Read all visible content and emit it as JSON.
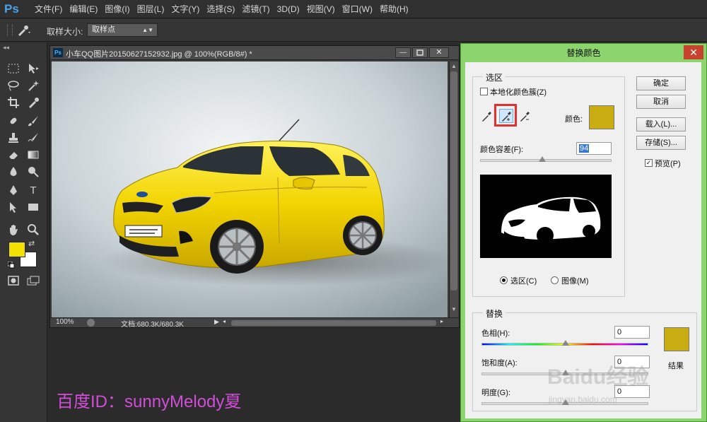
{
  "app": {
    "logo": "Ps"
  },
  "menu": [
    "文件(F)",
    "编辑(E)",
    "图像(I)",
    "图层(L)",
    "文字(Y)",
    "选择(S)",
    "滤镜(T)",
    "3D(D)",
    "视图(V)",
    "窗口(W)",
    "帮助(H)"
  ],
  "options": {
    "sample_size_label": "取样大小:",
    "sample_size_value": "取样点"
  },
  "colors": {
    "foreground": "#f2e000",
    "background": "#ffffff",
    "dialog_border": "#8bd46e"
  },
  "document": {
    "tab_icon": "Ps",
    "title": "小车QQ图片20150627152932.jpg @ 100%(RGB/8#) *",
    "zoom": "100%",
    "doc_size": "文档:680.3K/680.3K"
  },
  "dialog": {
    "title": "替换颜色",
    "selection_group": "选区",
    "localized_clusters": "本地化颜色簇(Z)",
    "color_label": "颜色:",
    "fuzziness_label": "颜色容差(F):",
    "fuzziness_value": "94",
    "fuzziness_percent": 0.47,
    "radio_selection": "选区(C)",
    "radio_image": "图像(M)",
    "selected_radio": "selection",
    "ok": "确定",
    "cancel": "取消",
    "load": "载入(L)...",
    "save": "存储(S)...",
    "preview": "预览(P)",
    "preview_checked": true,
    "sample_color": "#c9ad12",
    "replace_group": "替换",
    "hue_label": "色相(H):",
    "hue_value": "0",
    "saturation_label": "饱和度(A):",
    "saturation_value": "0",
    "lightness_label": "明度(G):",
    "lightness_value": "0",
    "result_label": "结果",
    "result_color": "#c9ad12"
  },
  "watermark": "百度ID：sunnyMelody夏",
  "baidu_mark": "Baidu经验",
  "baidu_url": "jingyan.baidu.com"
}
